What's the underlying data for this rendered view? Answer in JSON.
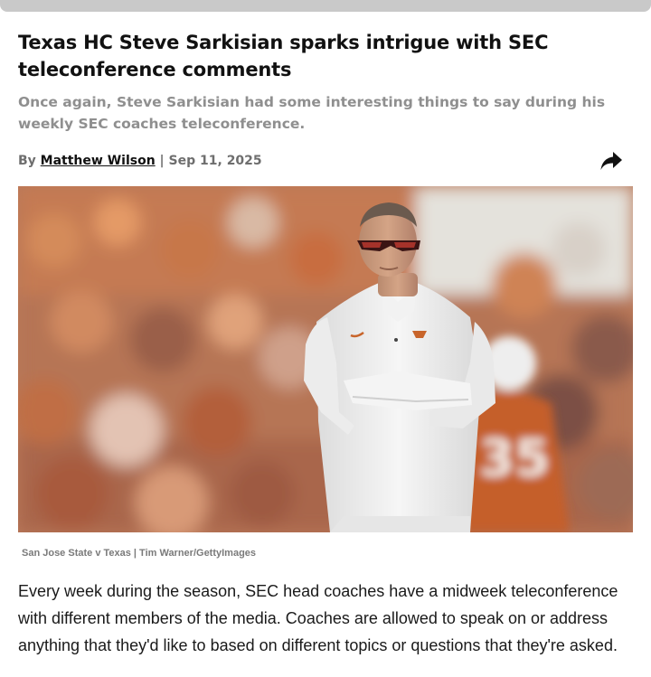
{
  "article": {
    "headline": "Texas HC Steve Sarkisian sparks intrigue with SEC teleconference comments",
    "subheadline": "Once again, Steve Sarkisian had some interesting things to say during his weekly SEC coaches teleconference.",
    "byline": {
      "prefix": "By",
      "author": "Matthew Wilson",
      "separator": "|",
      "date": "Sep 11, 2025"
    },
    "share_icon": "share-arrow-icon",
    "image": {
      "subject": "coach-portrait-photo",
      "jersey_number": "35"
    },
    "caption": "San Jose State v Texas | Tim Warner/GettyImages",
    "body": "Every week during the season, SEC head coaches have a midweek teleconference with different members of the media. Coaches are allowed to speak on or address anything that they'd like to based on different topics or questions that they're asked."
  },
  "colors": {
    "accent_orange": "#c8642a",
    "muted_text": "#8f8f8f",
    "top_bar": "#c9c9c9"
  }
}
